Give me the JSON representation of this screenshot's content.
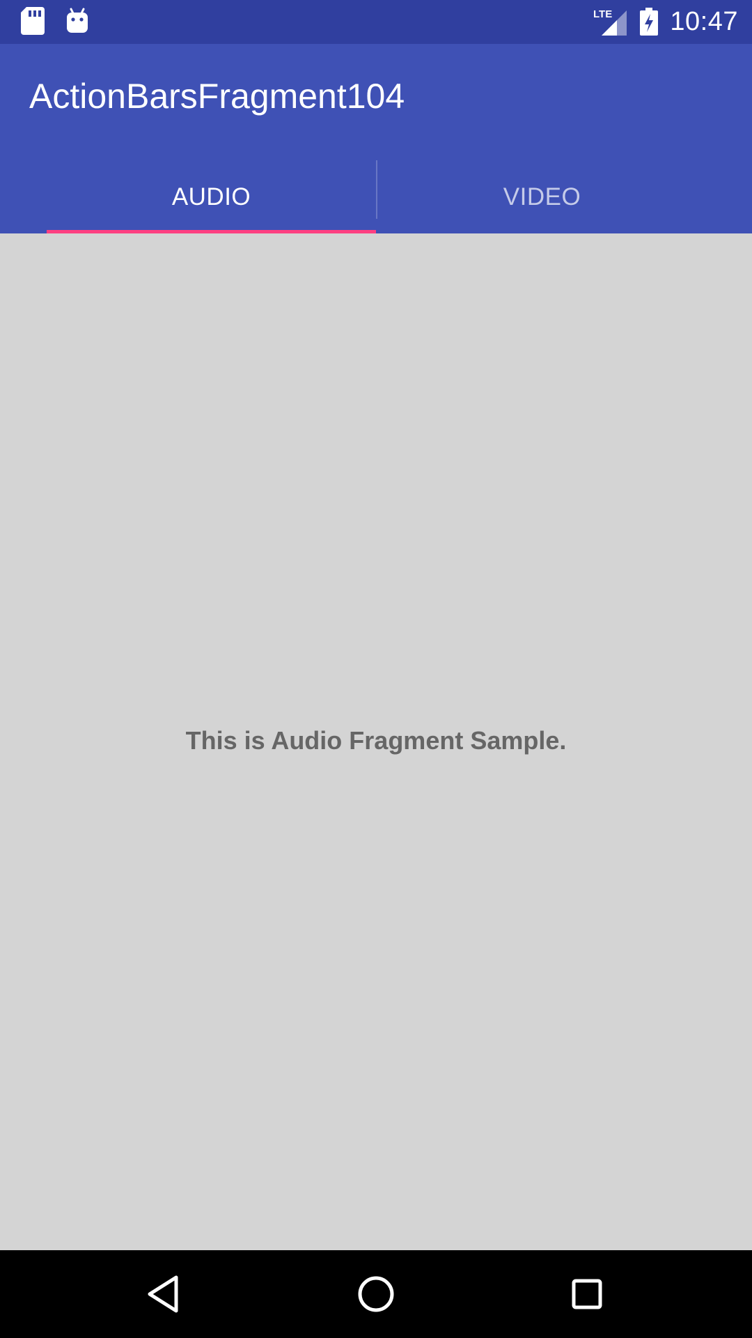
{
  "status_bar": {
    "time": "10:47",
    "network_label": "LTE",
    "icons": [
      "sd-card-icon",
      "android-icon",
      "lte-signal-icon",
      "battery-charging-icon"
    ]
  },
  "app_bar": {
    "title": "ActionBarsFragment104"
  },
  "tabs": [
    {
      "label": "AUDIO",
      "selected": true
    },
    {
      "label": "VIDEO",
      "selected": false
    }
  ],
  "content": {
    "message": "This is Audio Fragment Sample."
  },
  "nav_bar": {
    "icons": [
      "back-icon",
      "home-icon",
      "recents-icon"
    ]
  },
  "colors": {
    "status_bar": "#303f9f",
    "primary": "#3f51b5",
    "accent": "#ff4081",
    "background": "#d4d4d4",
    "message_text": "#666666"
  }
}
